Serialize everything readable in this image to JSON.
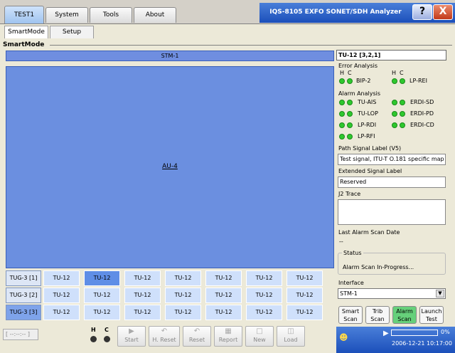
{
  "tabs": [
    "TEST1",
    "System",
    "Tools",
    "About"
  ],
  "app_title": "IQS-8105  EXFO  SONET/SDH Analyzer",
  "help_label": "?",
  "close_label": "X",
  "subtabs": [
    "SmartMode",
    "Setup"
  ],
  "section_title": "SmartMode",
  "map": {
    "stm_label": "STM-1",
    "au_label": "AU-4",
    "tug_rows": [
      {
        "tug": "TUG-3 [1]",
        "cells": [
          "TU-12",
          "TU-12",
          "TU-12",
          "TU-12",
          "TU-12",
          "TU-12",
          "TU-12"
        ]
      },
      {
        "tug": "TUG-3 [2]",
        "cells": [
          "TU-12",
          "TU-12",
          "TU-12",
          "TU-12",
          "TU-12",
          "TU-12",
          "TU-12"
        ]
      },
      {
        "tug": "TUG-3 [3]",
        "cells": [
          "TU-12",
          "TU-12",
          "TU-12",
          "TU-12",
          "TU-12",
          "TU-12",
          "TU-12"
        ]
      }
    ]
  },
  "bottom": {
    "time": "[ --:--:-- ]",
    "h_label": "H",
    "c_label": "C",
    "buttons": [
      "Start",
      "H. Reset",
      "Reset",
      "Report",
      "New",
      "Load"
    ]
  },
  "right": {
    "title": "TU-12 [3,2,1]",
    "error_analysis": "Error Analysis",
    "h": "H",
    "c": "C",
    "error_items": [
      "BIP-2",
      "LP-REI"
    ],
    "alarm_analysis": "Alarm Analysis",
    "alarm_left": [
      "TU-AIS",
      "TU-LOP",
      "LP-RDI",
      "LP-RFI"
    ],
    "alarm_right": [
      "ERDI-SD",
      "ERDI-PD",
      "ERDI-CD"
    ],
    "path_label_title": "Path Signal Label (V5)",
    "path_label_value": "Test signal, ITU-T O.181 specific map",
    "ext_label_title": "Extended Signal Label",
    "ext_label_value": "Reserved",
    "j2_title": "J2 Trace",
    "j2_value": "",
    "last_scan_title": "Last Alarm Scan Date",
    "last_scan_value": "--",
    "status_title": "Status",
    "status_value": "Alarm Scan In-Progress...",
    "interface_title": "Interface",
    "interface_value": "STM-1",
    "buttons": [
      {
        "l1": "Smart",
        "l2": "Scan"
      },
      {
        "l1": "Trib",
        "l2": "Scan"
      },
      {
        "l1": "Alarm",
        "l2": "Scan"
      },
      {
        "l1": "Launch",
        "l2": "Test"
      }
    ]
  },
  "statusbar": {
    "percent": "0%",
    "datetime": "2006-12-21 10:17:00"
  },
  "colors": {
    "accent": "#1b4fba",
    "led_green": "#2ec82e",
    "selected_cell": "#5f8ee6",
    "active_button": "#66d07a"
  }
}
